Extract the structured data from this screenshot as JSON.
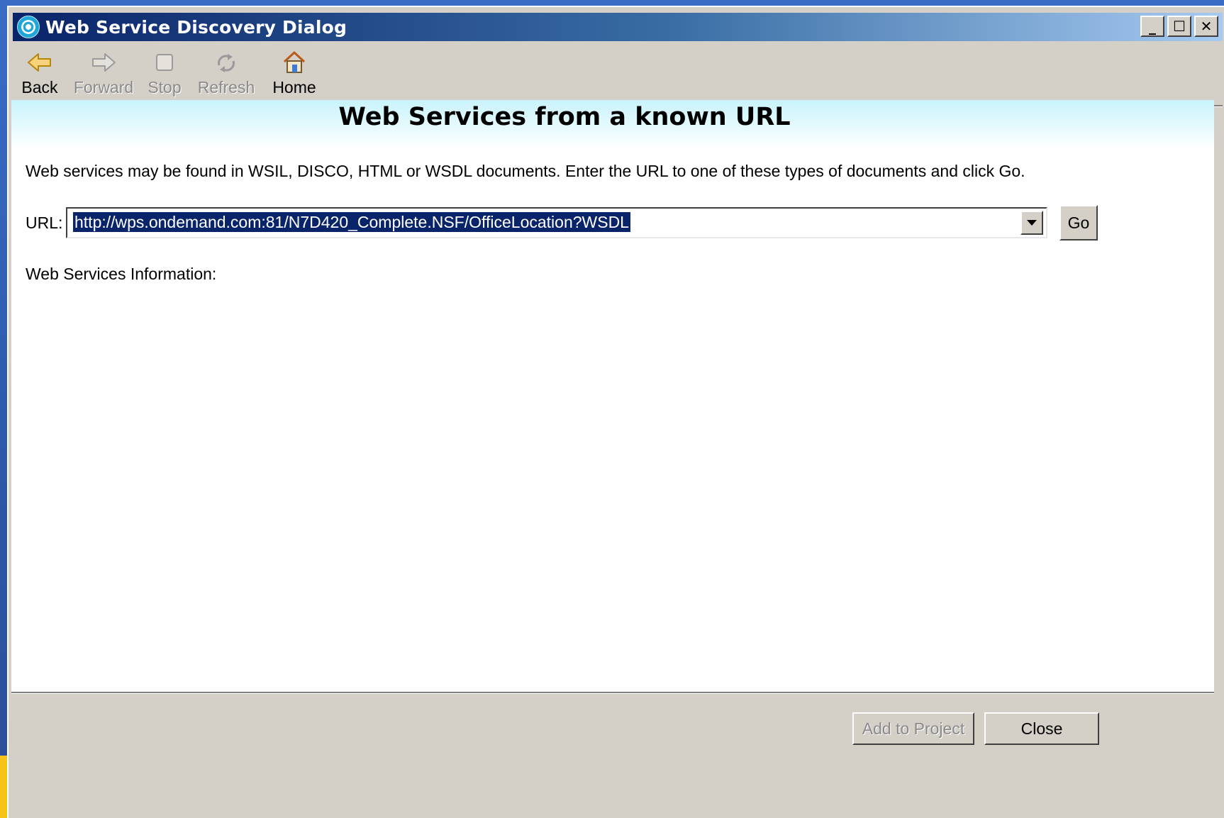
{
  "window": {
    "title": "Web Service Discovery Dialog",
    "minimize_glyph": "_",
    "maximize_glyph": "☐",
    "close_glyph": "✕"
  },
  "toolbar": {
    "items": [
      {
        "label": "Back",
        "icon": "back-arrow-icon",
        "enabled": true
      },
      {
        "label": "Forward",
        "icon": "forward-arrow-icon",
        "enabled": false
      },
      {
        "label": "Stop",
        "icon": "stop-icon",
        "enabled": false
      },
      {
        "label": "Refresh",
        "icon": "refresh-icon",
        "enabled": false
      },
      {
        "label": "Home",
        "icon": "home-icon",
        "enabled": true
      }
    ]
  },
  "main": {
    "title": "Web Services from a known URL",
    "description": "Web services may be found in WSIL, DISCO, HTML or WSDL documents. Enter the URL to one of these types of documents and click Go.",
    "url_label": "URL:",
    "url_value": "http://wps.ondemand.com:81/N7D420_Complete.NSF/OfficeLocation?WSDL",
    "go_label": "Go",
    "info_label": "Web Services Information:"
  },
  "footer": {
    "add_to_project_label": "Add to Project",
    "close_label": "Close"
  },
  "colors": {
    "titlebar_start": "#0a246a",
    "titlebar_end": "#a6caf0",
    "selection": "#0a246a",
    "banner": "#c9f3fb",
    "dialog_face": "#d4d0c8",
    "accent_yellow": "#f6c31a"
  }
}
